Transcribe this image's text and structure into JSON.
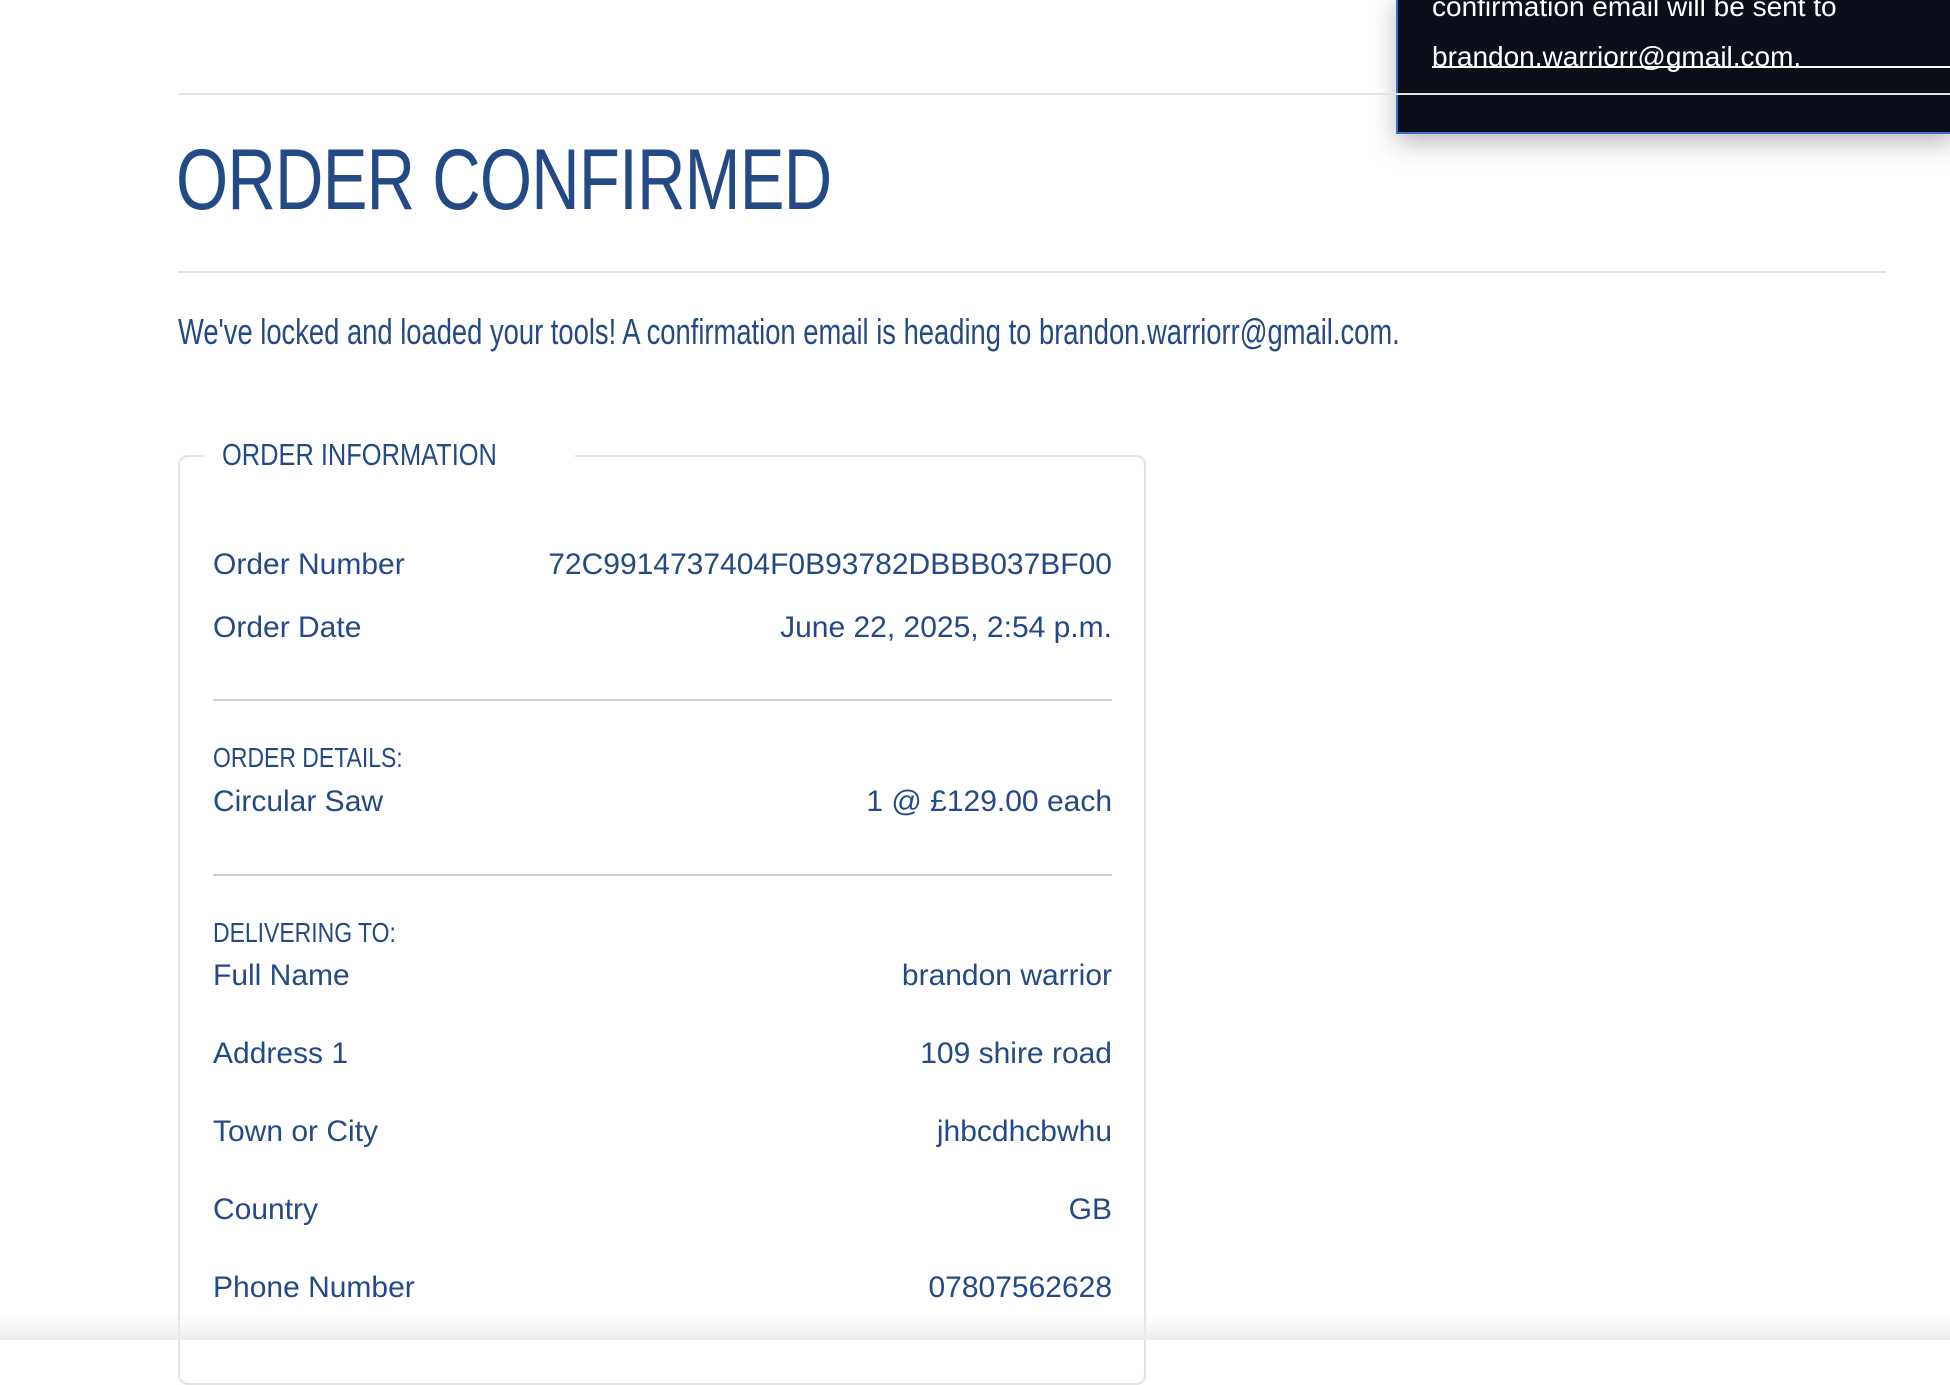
{
  "toast": {
    "line1": "confirmation email will be sent to",
    "line2": "brandon.warriorr@gmail.com."
  },
  "page": {
    "title": "ORDER CONFIRMED",
    "message": "We've locked and loaded your tools! A confirmation email is heading to brandon.warriorr@gmail.com."
  },
  "order_info": {
    "legend": "ORDER INFORMATION",
    "order_number_label": "Order Number",
    "order_number": "72C9914737404F0B93782DBBB037BF00",
    "order_date_label": "Order Date",
    "order_date": "June 22, 2025, 2:54 p.m.",
    "details_heading": "ORDER DETAILS:",
    "items": [
      {
        "name": "Circular Saw",
        "qty_price": "1 @ £129.00 each"
      }
    ],
    "delivery_heading": "DELIVERING TO:",
    "delivery": {
      "full_name_label": "Full Name",
      "full_name": "brandon warrior",
      "address1_label": "Address 1",
      "address1": "109 shire road",
      "town_label": "Town or City",
      "town": "jhbcdhcbwhu",
      "country_label": "Country",
      "country": "GB",
      "phone_label": "Phone Number",
      "phone": "07807562628"
    }
  }
}
